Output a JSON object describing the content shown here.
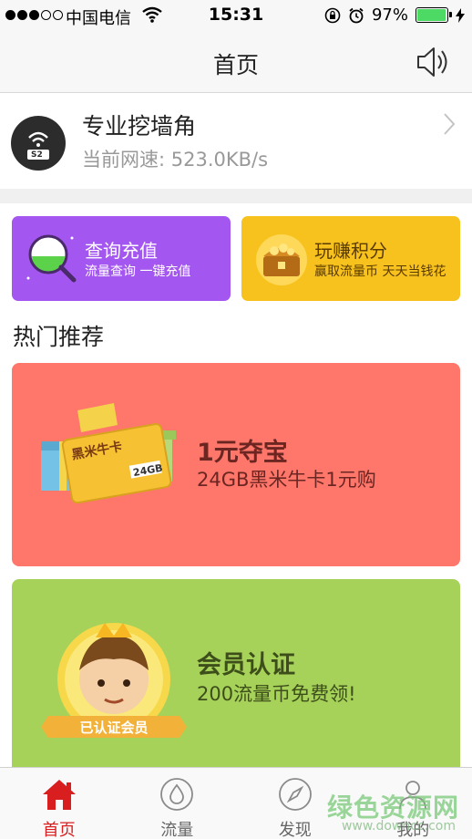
{
  "status_bar": {
    "carrier": "中国电信",
    "time": "15:31",
    "battery_percent": "97%",
    "battery_level": 0.97,
    "signal_bars": [
      true,
      true,
      true,
      false,
      false
    ]
  },
  "nav": {
    "title": "首页"
  },
  "device": {
    "badge": "S2",
    "name": "专业挖墙角",
    "speed": "当前网速: 523.0KB/s"
  },
  "tiles": [
    {
      "title": "查询充值",
      "subtitle": "流量查询  一键充值"
    },
    {
      "title": "玩赚积分",
      "subtitle": "赢取流量币  天天当钱花"
    }
  ],
  "section": {
    "title": "热门推荐"
  },
  "promos": [
    {
      "title": "1元夺宝",
      "subtitle": "24GB黑米牛卡1元购",
      "card_text": "黑米牛卡",
      "card_badge": "24GB"
    },
    {
      "title": "会员认证",
      "subtitle": "200流量币免费领!",
      "badge_text": "已认证会员"
    }
  ],
  "tabs": [
    {
      "label": "首页",
      "icon": "home-icon",
      "active": true
    },
    {
      "label": "流量",
      "icon": "drop-icon",
      "active": false
    },
    {
      "label": "发现",
      "icon": "compass-icon",
      "active": false
    },
    {
      "label": "我的",
      "icon": "user-icon",
      "active": false
    }
  ],
  "watermark": {
    "text": "绿色资源网",
    "sub": "www.downcc.com"
  },
  "colors": {
    "accent": "#d81e1e",
    "purple_tile": "#a456f0",
    "yellow_tile": "#f8c21e",
    "red_promo": "#ff766b",
    "green_promo": "#a6d25a"
  }
}
